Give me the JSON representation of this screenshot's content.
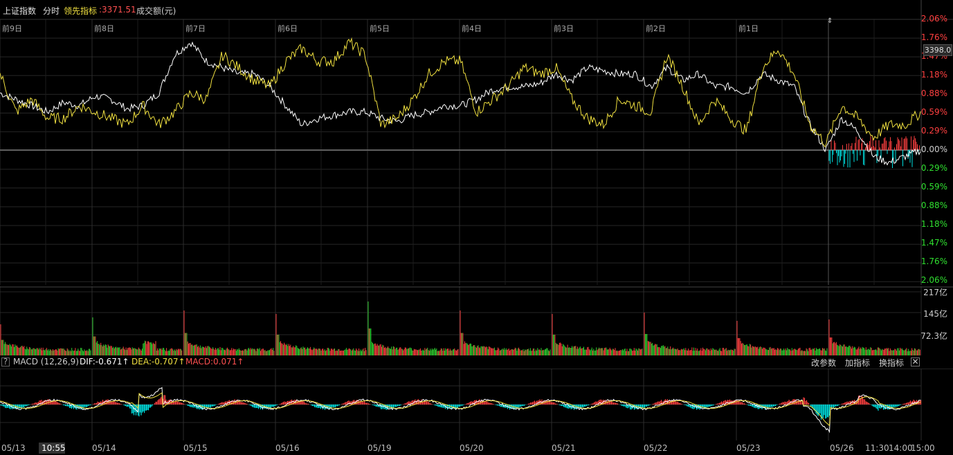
{
  "topbar": {
    "index_name": "上证指数",
    "mode": "分时",
    "leading_label": "领先指标",
    "leading_value": ":3371.51",
    "volume_label": "成交额(元)"
  },
  "day_labels": [
    "前9日",
    "前8日",
    "前7日",
    "前6日",
    "前5日",
    "前4日",
    "前3日",
    "前2日",
    "前1日"
  ],
  "y_axis": {
    "up": [
      "2.06%",
      "1.76%",
      "1.47%",
      "1.18%",
      "0.88%",
      "0.59%",
      "0.29%"
    ],
    "zero": "0.00%",
    "down": [
      "0.29%",
      "0.59%",
      "0.88%",
      "1.18%",
      "1.47%",
      "1.76%",
      "2.06%"
    ],
    "price_tag": "3398.0"
  },
  "vol_axis": [
    "217亿",
    "145亿",
    "72.3亿"
  ],
  "macd": {
    "help": "?",
    "name": "MACD (12,26,9)",
    "dif": "DIF:-0.671↑",
    "dea": "DEA:-0.707↑",
    "macd": "MACD:0.071↑",
    "btn_params": "改参数",
    "btn_add": "加指标",
    "btn_switch": "换指标",
    "btn_close": "✕"
  },
  "dates": [
    "05/13",
    "10:55",
    "05/14",
    "05/15",
    "05/16",
    "05/19",
    "05/20",
    "05/21",
    "05/22",
    "05/23",
    "05/26",
    "11:30",
    "14:00",
    "15:00"
  ],
  "colors": {
    "up": "#ff4040",
    "down": "#00e0e0",
    "white_line": "#ffffff",
    "yellow_line": "#f0e040",
    "grid": "#2a2a2a",
    "zero_line": "#777777"
  },
  "chart_data": {
    "type": "line",
    "title": "",
    "ylim_percent": [
      -2.06,
      2.06
    ],
    "note_days": [
      "05/13",
      "05/14",
      "05/15",
      "05/16",
      "05/19",
      "05/20",
      "05/21",
      "05/22",
      "05/23",
      "05/26"
    ],
    "series": [
      {
        "name": "上证指数",
        "values": [
          0.9,
          0.8,
          0.7,
          0.6,
          0.75,
          0.7,
          0.85,
          0.8,
          0.65,
          0.7,
          0.9,
          1.5,
          1.7,
          1.4,
          1.3,
          1.2,
          1.2,
          1.0,
          0.7,
          0.4,
          0.5,
          0.55,
          0.6,
          0.6,
          0.5,
          0.45,
          0.55,
          0.6,
          0.7,
          0.7,
          0.8,
          0.95,
          1.0,
          1.0,
          1.05,
          1.2,
          1.1,
          1.3,
          1.25,
          1.2,
          1.2,
          1.0,
          1.3,
          1.1,
          1.2,
          1.0,
          1.0,
          0.9,
          1.2,
          1.1,
          1.0,
          0.4,
          0.0,
          0.5,
          0.3,
          -0.1,
          -0.2,
          -0.1,
          0.0
        ]
      },
      {
        "name": "领先指标",
        "values": [
          1.2,
          0.6,
          0.8,
          0.5,
          0.5,
          0.7,
          0.6,
          0.5,
          0.4,
          0.7,
          0.4,
          0.6,
          0.9,
          0.8,
          1.5,
          1.3,
          1.1,
          1.0,
          1.4,
          1.6,
          1.4,
          1.4,
          1.7,
          1.5,
          0.4,
          0.5,
          0.8,
          1.2,
          1.4,
          1.4,
          0.6,
          0.8,
          1.0,
          1.3,
          1.2,
          1.3,
          0.8,
          0.5,
          0.4,
          0.8,
          0.7,
          0.6,
          1.5,
          1.0,
          0.4,
          0.8,
          0.5,
          0.3,
          1.3,
          1.6,
          1.2,
          0.4,
          0.1,
          0.7,
          0.5,
          0.2,
          0.4,
          0.4,
          0.6
        ]
      }
    ]
  }
}
